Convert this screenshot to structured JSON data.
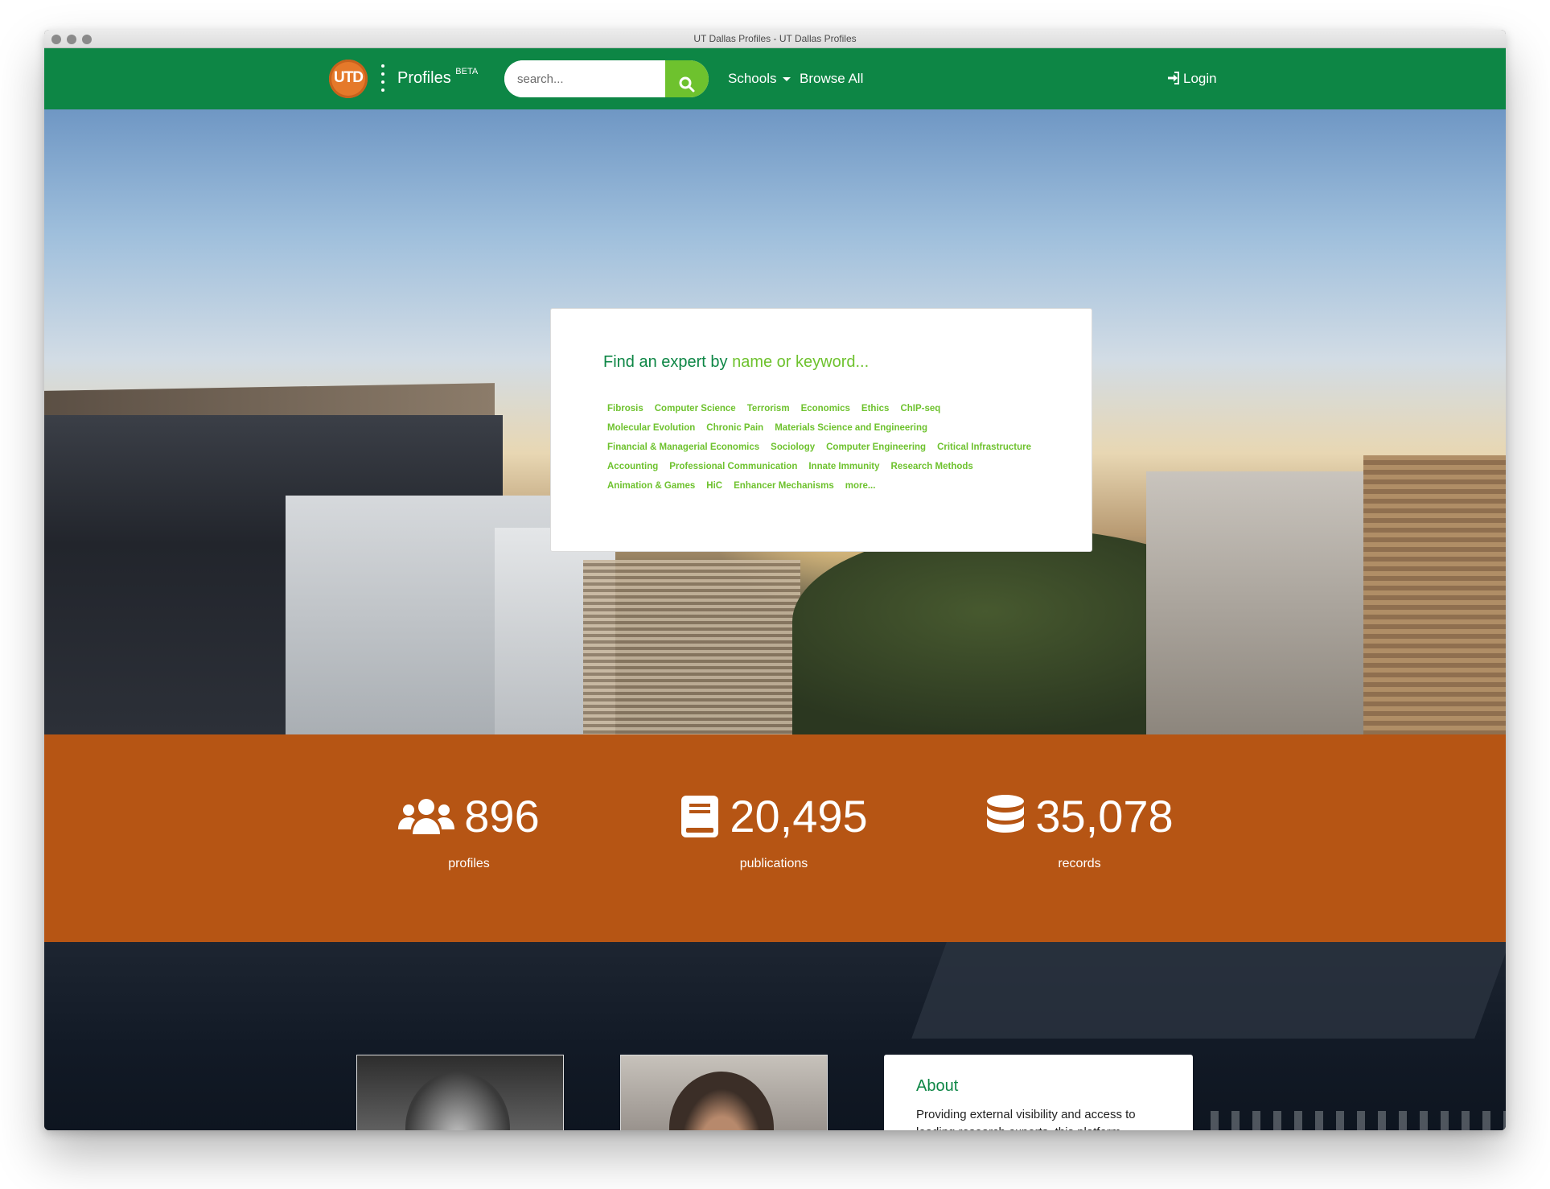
{
  "window": {
    "title": "UT Dallas Profiles - UT Dallas Profiles"
  },
  "navbar": {
    "logo_text": "UTD",
    "brand": "Profiles",
    "brand_badge": "BETA",
    "search_placeholder": "search...",
    "schools_label": "Schools",
    "browse_label": "Browse All",
    "login_label": "Login",
    "colors": {
      "navbar": "#0d8645",
      "search_button": "#6ec22e",
      "logo": "#e5792a"
    }
  },
  "expert_search": {
    "heading_prefix": "Find an expert by",
    "heading_keyword": "name or keyword...",
    "tag_rows": [
      [
        "Fibrosis",
        "Computer Science",
        "Terrorism",
        "Economics",
        "Ethics",
        "ChIP-seq"
      ],
      [
        "Molecular Evolution",
        "Chronic Pain",
        "Materials Science and Engineering"
      ],
      [
        "Financial & Managerial Economics",
        "Sociology",
        "Computer Engineering",
        "Critical Infrastructure"
      ],
      [
        "Accounting",
        "Professional Communication",
        "Innate Immunity",
        "Research Methods"
      ],
      [
        "Animation & Games",
        "HiC",
        "Enhancer Mechanisms",
        "more..."
      ]
    ]
  },
  "stats": [
    {
      "icon": "users-icon",
      "value": "896",
      "label": "profiles"
    },
    {
      "icon": "book-icon",
      "value": "20,495",
      "label": "publications"
    },
    {
      "icon": "database-icon",
      "value": "35,078",
      "label": "records"
    }
  ],
  "about": {
    "title": "About",
    "text": "Providing external visibility and access to leading research experts, this platform"
  }
}
